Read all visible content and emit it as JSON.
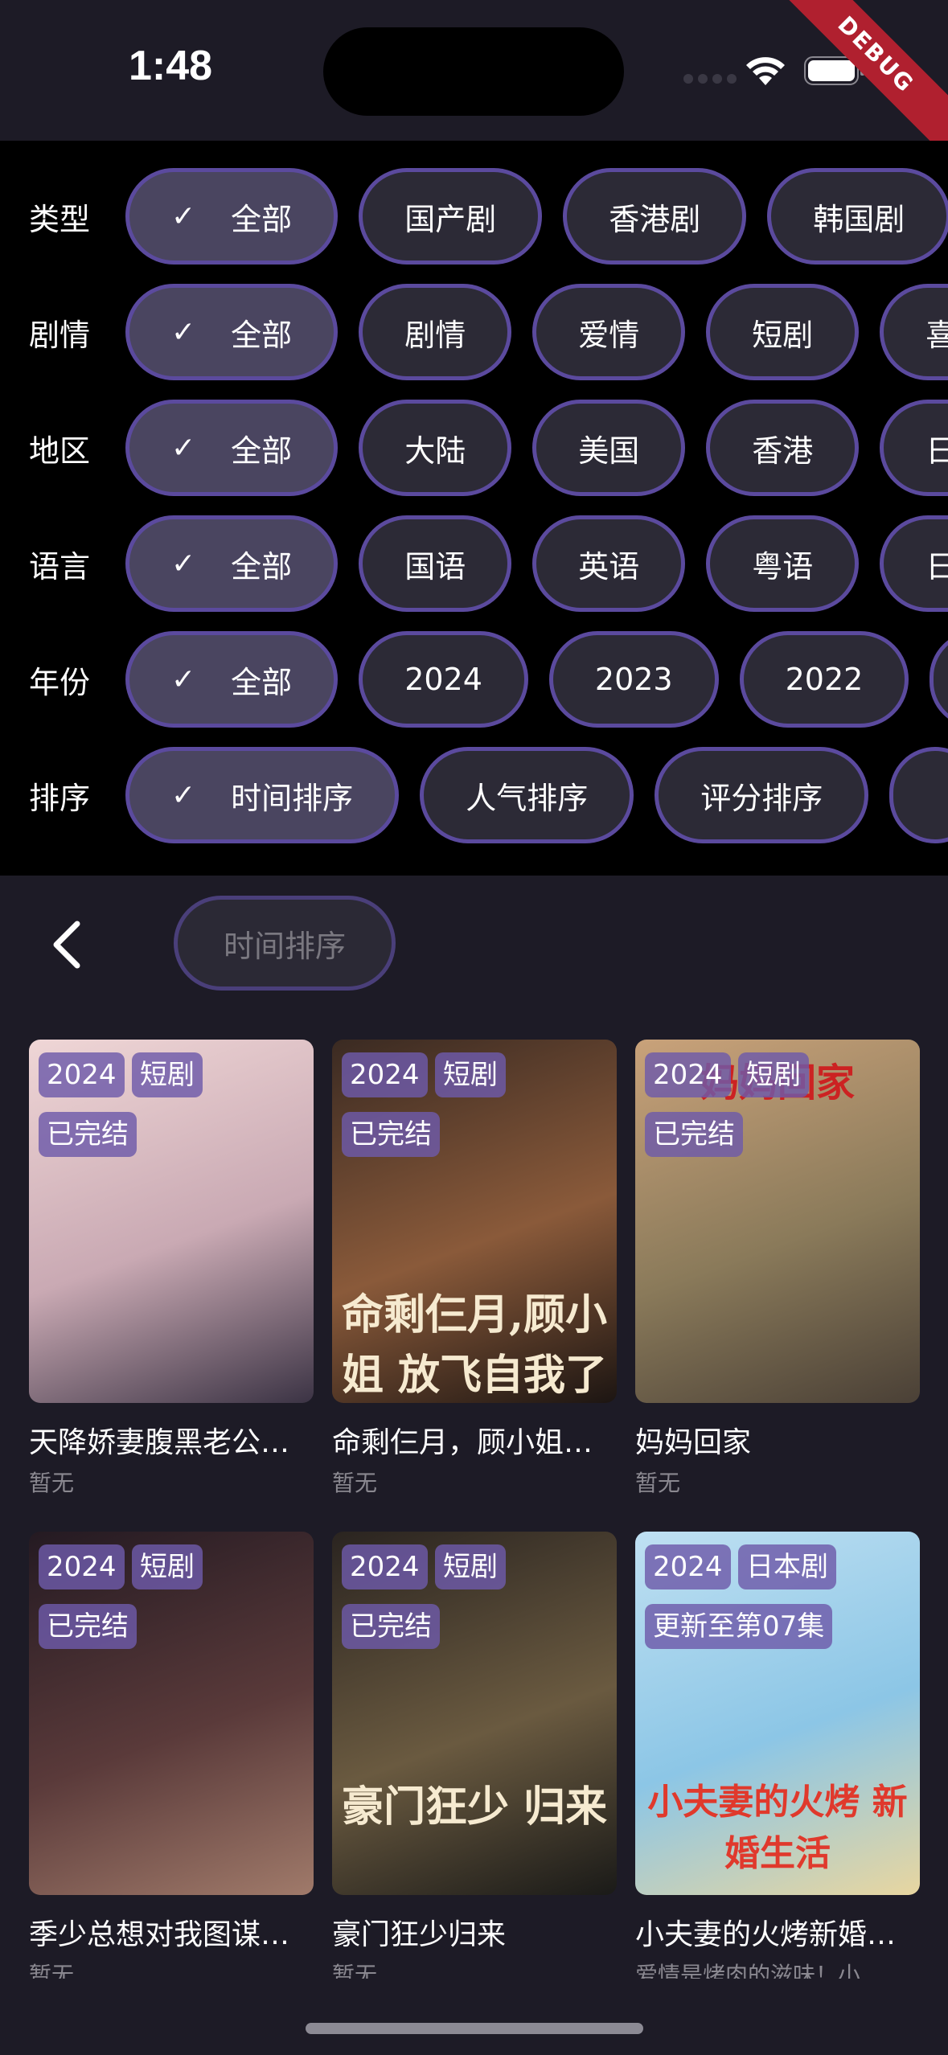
{
  "status_bar": {
    "time": "1:48",
    "debug_label": "DEBUG"
  },
  "filters": [
    {
      "label": "类型",
      "options": [
        "全部",
        "国产剧",
        "香港剧",
        "韩国剧"
      ],
      "selected": 0
    },
    {
      "label": "剧情",
      "options": [
        "全部",
        "剧情",
        "爱情",
        "短剧",
        "喜"
      ],
      "selected": 0
    },
    {
      "label": "地区",
      "options": [
        "全部",
        "大陆",
        "美国",
        "香港",
        "日"
      ],
      "selected": 0
    },
    {
      "label": "语言",
      "options": [
        "全部",
        "国语",
        "英语",
        "粤语",
        "日"
      ],
      "selected": 0
    },
    {
      "label": "年份",
      "options": [
        "全部",
        "2024",
        "2023",
        "2022",
        ""
      ],
      "selected": 0
    },
    {
      "label": "排序",
      "options": [
        "时间排序",
        "人气排序",
        "评分排序",
        ""
      ],
      "selected": 0
    }
  ],
  "sort_bar": {
    "current_sort": "时间排序"
  },
  "cards": [
    {
      "badges": [
        "2024",
        "短剧",
        "已完结"
      ],
      "title": "天降娇妻腹黑老公…",
      "subtitle": "暂无",
      "poster_text": "",
      "colors": [
        "#efd6d6",
        "#c9a9b3",
        "#3b3344"
      ]
    },
    {
      "badges": [
        "2024",
        "短剧",
        "已完结"
      ],
      "title": "命剩仨月，顾小姐…",
      "subtitle": "暂无",
      "poster_text": "命剩仨月,顾小姐 放飞自我了",
      "colors": [
        "#3a2a22",
        "#8a5a3a",
        "#1c1512"
      ]
    },
    {
      "badges": [
        "2024",
        "短剧",
        "已完结"
      ],
      "title": "妈妈回家",
      "subtitle": "暂无",
      "poster_text": "妈妈回家",
      "colors": [
        "#c9a27a",
        "#8a7a5a",
        "#4a4036"
      ]
    },
    {
      "badges": [
        "2024",
        "短剧",
        "已完结"
      ],
      "title": "季少总想对我图谋…",
      "subtitle": "暂无",
      "poster_text": "",
      "colors": [
        "#241a22",
        "#5a3a3a",
        "#a07a6a"
      ]
    },
    {
      "badges": [
        "2024",
        "短剧",
        "已完结"
      ],
      "title": "豪门狂少归来",
      "subtitle": "暂无",
      "poster_text": "豪门狂少 归来",
      "colors": [
        "#2a2420",
        "#6a5a40",
        "#1a1a18"
      ]
    },
    {
      "badges": [
        "2024",
        "日本剧",
        "更新至第07集"
      ],
      "title": "小夫妻的火烤新婚…",
      "subtitle": "爱情是烤肉的滋味！小…",
      "poster_text": "小夫妻的火烤 新婚生活",
      "colors": [
        "#bfe0f2",
        "#8cc6e6",
        "#e8d6a0"
      ]
    }
  ]
}
